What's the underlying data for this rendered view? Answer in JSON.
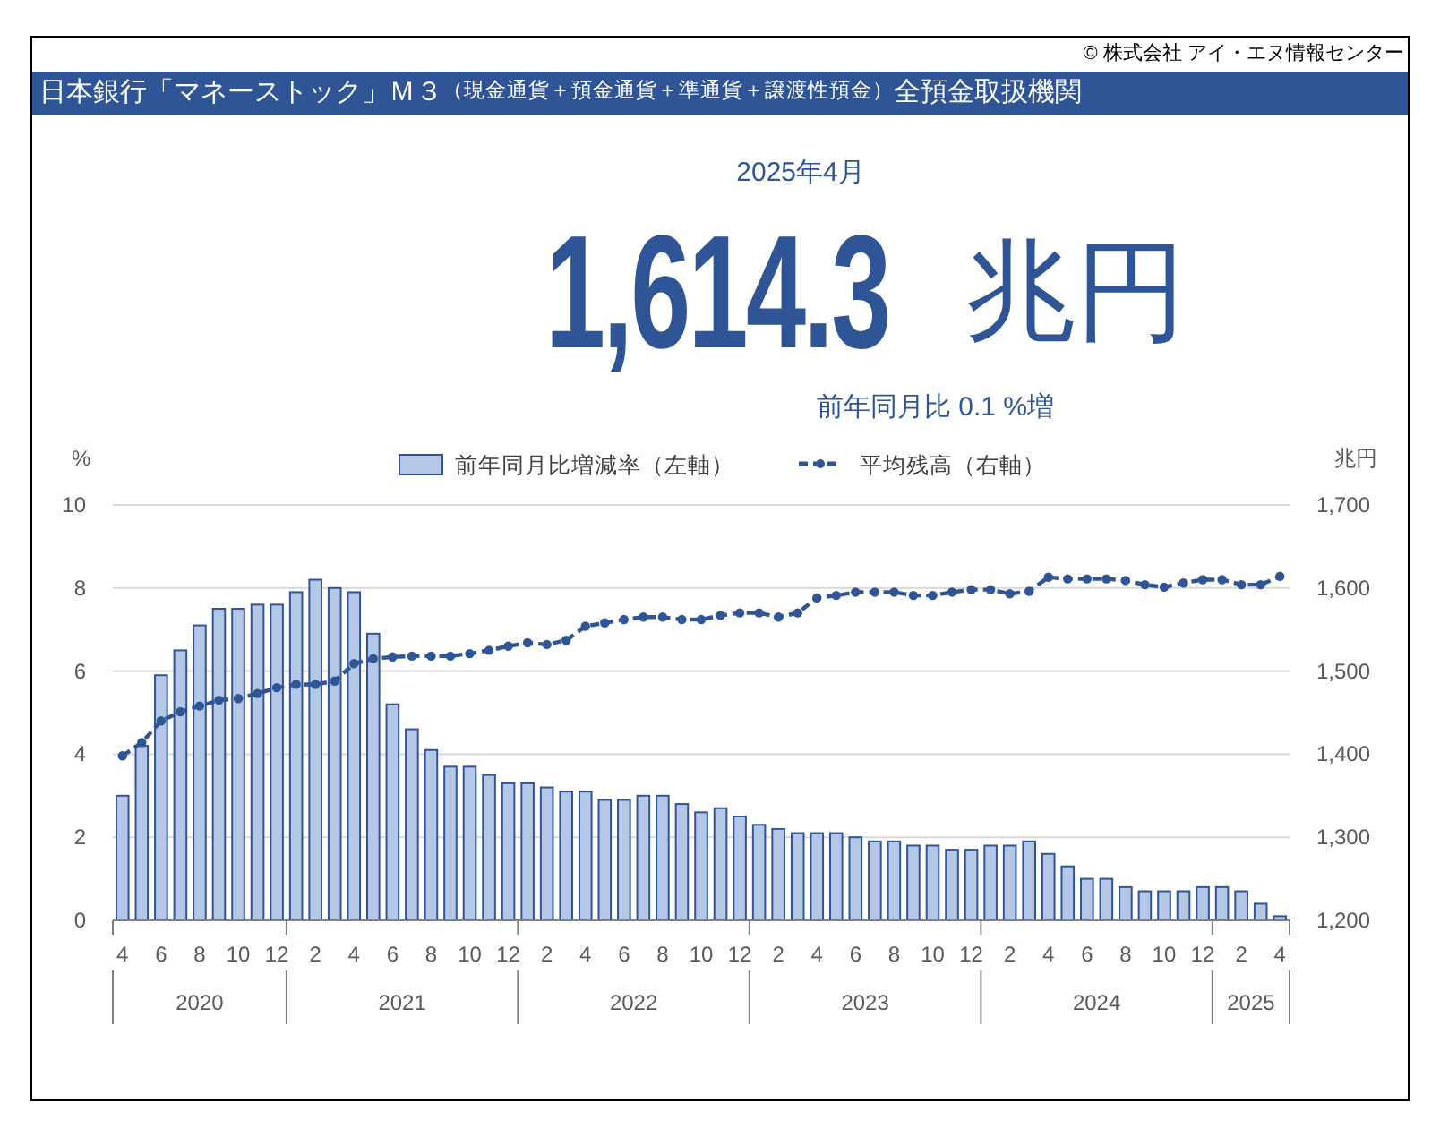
{
  "copyright": "© 株式会社 アイ・エヌ情報センター",
  "title": {
    "main": "日本銀行「マネーストック」Ｍ３",
    "sub": "（現金通貨＋預金通貨＋準通貨＋譲渡性預金）",
    "tail": "全預金取扱機関"
  },
  "headline": {
    "period": "2025年4月",
    "value": "1,614.3",
    "unit": "兆円",
    "change": "前年同月比 0.1 %増"
  },
  "chart": {
    "bar_chart": {
      "chart_data": {
        "type": "bar",
        "ylabel": "%",
        "ylim": [
          0,
          10
        ],
        "yticks": [
          0,
          2,
          4,
          6,
          8,
          10
        ],
        "grid": true,
        "categories": [
          "4",
          null,
          "6",
          null,
          "8",
          null,
          "10",
          null,
          "12",
          null,
          "2",
          null,
          "4",
          null,
          "6",
          null,
          "8",
          null,
          "10",
          null,
          "12",
          null,
          "2",
          null,
          "4",
          null,
          "6",
          null,
          "8",
          null,
          "10",
          null,
          "12",
          null,
          "2",
          null,
          "4",
          null,
          "6",
          null,
          "8",
          null,
          "10",
          null,
          "12",
          null,
          "2",
          null,
          "4",
          null,
          "6",
          null,
          "8",
          null,
          "10",
          null,
          "12",
          null,
          "2",
          null,
          "4"
        ],
        "series": [
          {
            "name": "前年同月比増減率（左軸）",
            "color": "#b4c7e7",
            "values": [
              3.0,
              4.2,
              5.9,
              6.5,
              7.1,
              7.5,
              7.5,
              7.6,
              7.6,
              7.9,
              8.2,
              8.0,
              7.9,
              6.9,
              5.2,
              4.6,
              4.1,
              3.7,
              3.7,
              3.5,
              3.3,
              3.3,
              3.2,
              3.1,
              3.1,
              2.9,
              2.9,
              3.0,
              3.0,
              2.8,
              2.6,
              2.7,
              2.5,
              2.3,
              2.2,
              2.1,
              2.1,
              2.1,
              2.0,
              1.9,
              1.9,
              1.8,
              1.8,
              1.7,
              1.7,
              1.8,
              1.8,
              1.9,
              1.6,
              1.3,
              1.0,
              1.0,
              0.8,
              0.7,
              0.7,
              0.7,
              0.8,
              0.8,
              0.7,
              0.4,
              0.1
            ]
          }
        ]
      }
    },
    "line_chart": {
      "chart_data": {
        "type": "line",
        "ylabel": "兆円",
        "ylim": [
          1200,
          1700
        ],
        "yticks": [
          {
            "value": 1200,
            "label": "1,200"
          },
          {
            "value": 1300,
            "label": "1,300"
          },
          {
            "value": 1400,
            "label": "1,400"
          },
          {
            "value": 1500,
            "label": "1,500"
          },
          {
            "value": 1600,
            "label": "1,600"
          },
          {
            "value": 1700,
            "label": "1,700"
          }
        ],
        "series": [
          {
            "name": "平均残高（右軸）",
            "color": "#2f5597",
            "line_style": "dashed",
            "marker": "circle",
            "values": [
              1398,
              1414,
              1440,
              1451,
              1458,
              1465,
              1467,
              1473,
              1480,
              1484,
              1484,
              1488,
              1509,
              1515,
              1517,
              1518,
              1518,
              1518,
              1521,
              1525,
              1530,
              1534,
              1532,
              1537,
              1554,
              1558,
              1562,
              1565,
              1565,
              1562,
              1562,
              1567,
              1570,
              1570,
              1565,
              1570,
              1588,
              1591,
              1595,
              1595,
              1595,
              1591,
              1591,
              1595,
              1598,
              1598,
              1593,
              1596,
              1613,
              1611,
              1611,
              1611,
              1609,
              1604,
              1601,
              1606,
              1610,
              1610,
              1604,
              1604,
              1614
            ]
          }
        ]
      }
    },
    "year_groups": [
      {
        "label": "2020"
      },
      {
        "label": "2021"
      },
      {
        "label": "2022"
      },
      {
        "label": "2023"
      },
      {
        "label": "2024"
      },
      {
        "label": "2025"
      }
    ]
  }
}
